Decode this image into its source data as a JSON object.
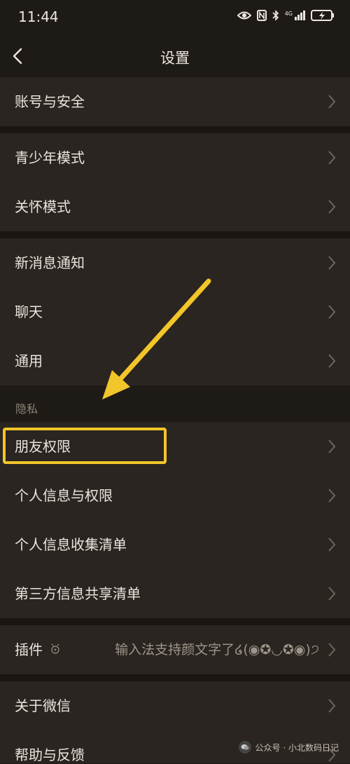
{
  "status_bar": {
    "time": "11:44",
    "network": "4G"
  },
  "header": {
    "title": "设置"
  },
  "rows": {
    "account": "账号与安全",
    "youth": "青少年模式",
    "care": "关怀模式",
    "notify": "新消息通知",
    "chat": "聊天",
    "general": "通用",
    "friends_perm": "朋友权限",
    "personal_info_perm": "个人信息与权限",
    "personal_info_list": "个人信息收集清单",
    "third_party_list": "第三方信息共享清单",
    "plugins": "插件",
    "plugins_value": "输入法支持颜文字了໒(◉✪◡✪◉)੭",
    "about": "关于微信",
    "help": "帮助与反馈"
  },
  "sections": {
    "privacy": "隐私"
  },
  "watermark": {
    "text": "公众号 · 小北数码日记"
  },
  "colors": {
    "highlight": "#f2c52a",
    "background": "#1e1a15",
    "row": "#2a2520"
  },
  "icons": [
    "back-icon",
    "chevron-right-icon",
    "eye-icon",
    "nfc-icon",
    "bluetooth-icon",
    "signal-icon",
    "battery-icon",
    "plugin-icon",
    "wechat-icon"
  ]
}
